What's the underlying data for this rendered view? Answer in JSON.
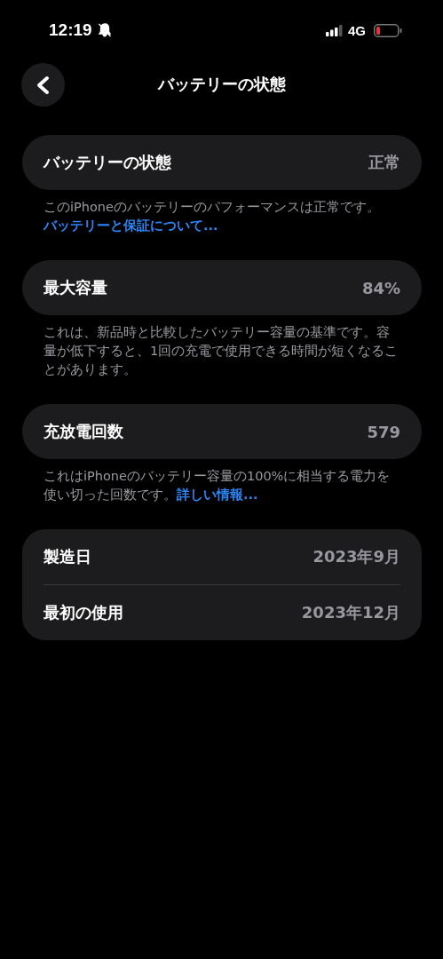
{
  "status_bar": {
    "time": "12:19",
    "network": "4G"
  },
  "nav": {
    "title": "バッテリーの状態"
  },
  "sections": [
    {
      "rows": [
        {
          "label": "バッテリーの状態",
          "value": "正常"
        }
      ],
      "footer": {
        "text": "このiPhoneのバッテリーのパフォーマンスは正常です。",
        "link": "バッテリーと保証について..."
      }
    },
    {
      "rows": [
        {
          "label": "最大容量",
          "value": "84%"
        }
      ],
      "footer": {
        "text": "これは、新品時と比較したバッテリー容量の基準です。容量が低下すると、1回の充電で使用できる時間が短くなることがあります。"
      }
    },
    {
      "rows": [
        {
          "label": "充放電回数",
          "value": "579"
        }
      ],
      "footer": {
        "text": "これはiPhoneのバッテリー容量の100%に相当する電力を使い切った回数です。",
        "link": "詳しい情報..."
      }
    },
    {
      "rows": [
        {
          "label": "製造日",
          "value": "2023年9月"
        },
        {
          "label": "最初の使用",
          "value": "2023年12月"
        }
      ]
    }
  ]
}
